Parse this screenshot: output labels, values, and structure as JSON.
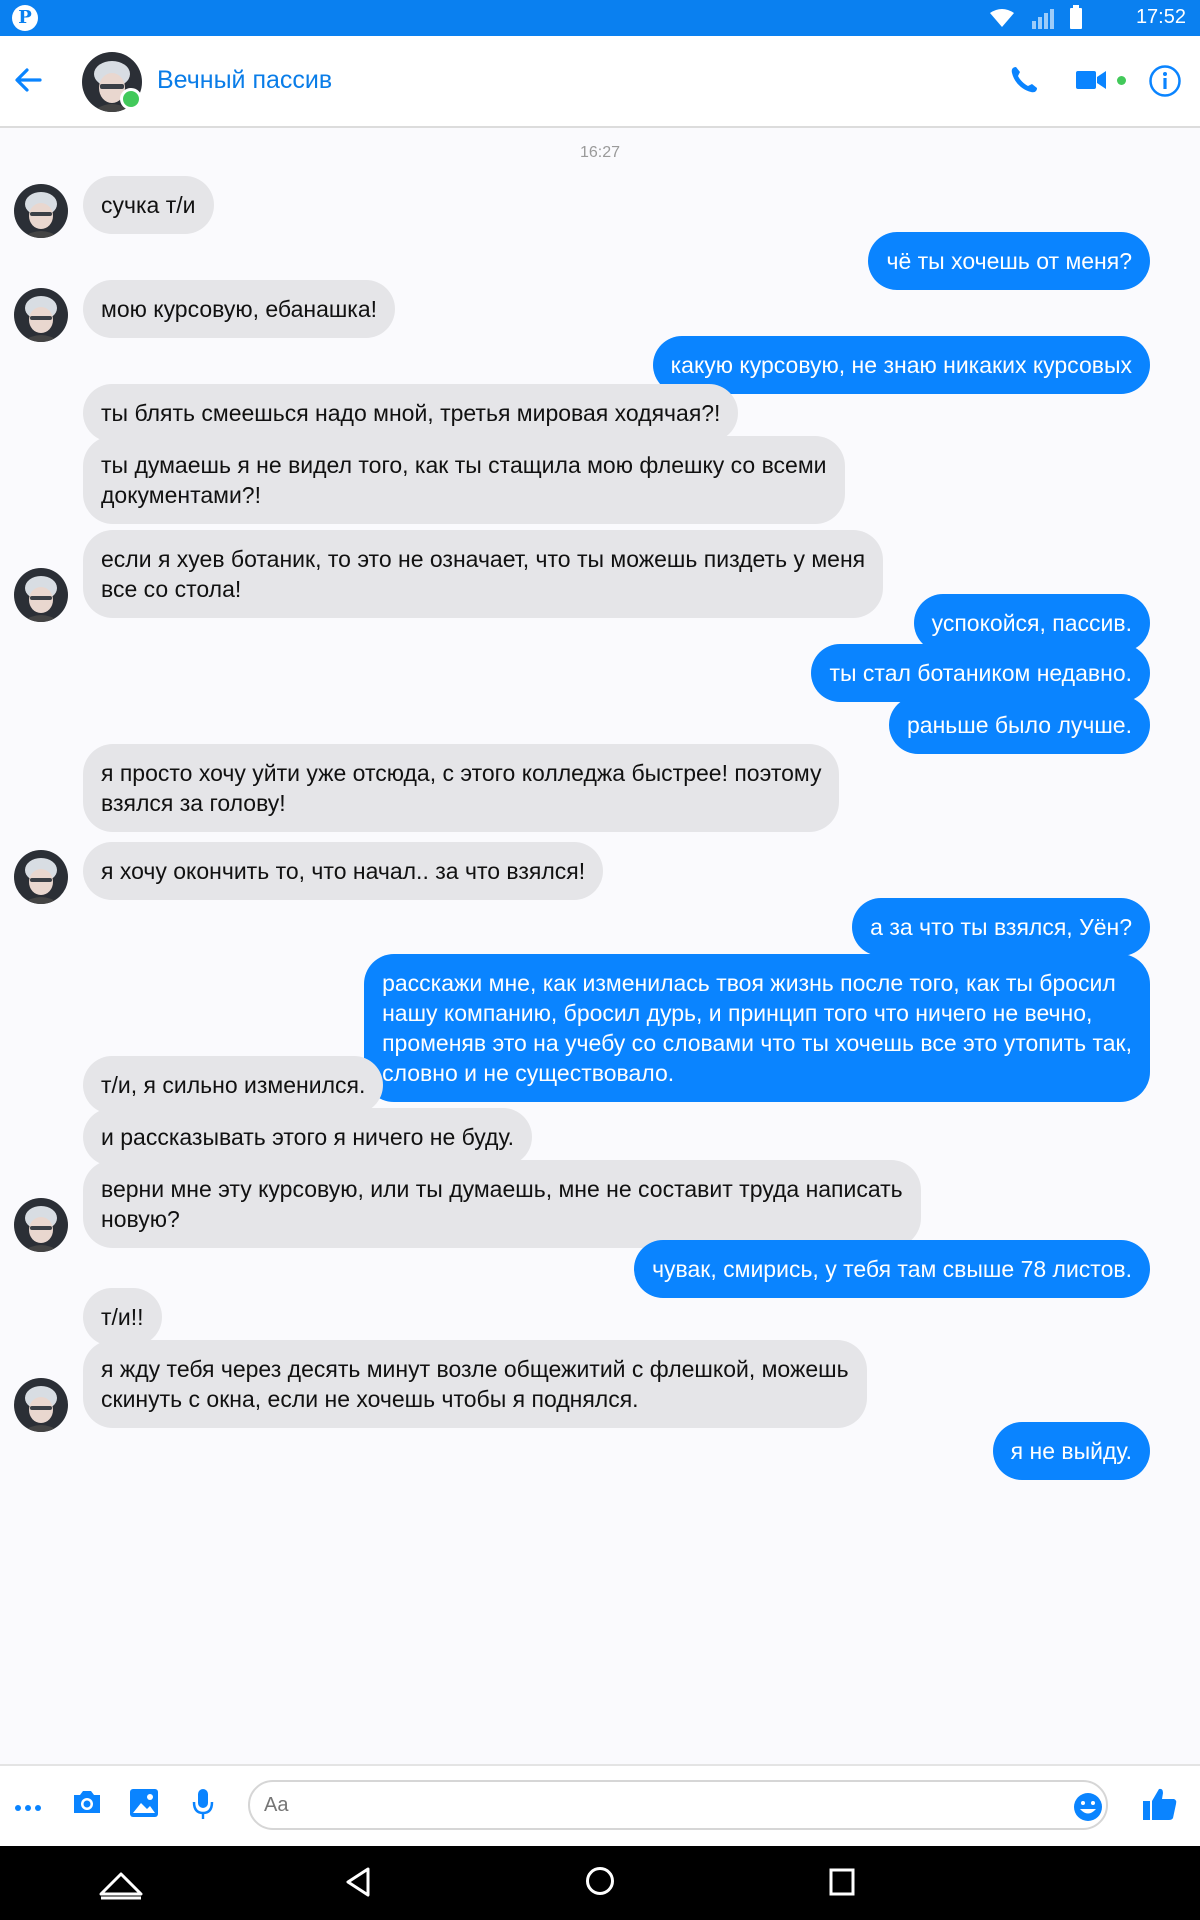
{
  "status_bar": {
    "time": "17:52"
  },
  "header": {
    "contact_name": "Вечный пассив",
    "online": true
  },
  "chat": {
    "timestamp": "16:27",
    "messages": [
      {
        "dir": "in",
        "text": "сучка т/и",
        "avatar": true
      },
      {
        "dir": "out",
        "text": "чё ты хочешь от меня?"
      },
      {
        "dir": "in",
        "text": "мою курсовую, ебанашка!",
        "avatar": true
      },
      {
        "dir": "out",
        "text": "какую курсовую, не знаю никаких курсовых"
      },
      {
        "dir": "in",
        "text": "ты блять смеешься надо мной, третья мировая ходячая?!"
      },
      {
        "dir": "in",
        "text": "ты думаешь я не видел того, как ты стащила мою флешку со всеми\nдокументами?!"
      },
      {
        "dir": "in",
        "text": "если я хуев ботаник, то это не означает, что ты можешь пиздеть у меня\nвсе со стола!",
        "avatar": true
      },
      {
        "dir": "out",
        "text": "успокойся, пассив."
      },
      {
        "dir": "out",
        "text": "ты стал ботаником недавно."
      },
      {
        "dir": "out",
        "text": "раньше было лучше."
      },
      {
        "dir": "in",
        "text": "я просто хочу уйти уже отсюда, с этого колледжа быстрее! поэтому\nвзялся за голову!"
      },
      {
        "dir": "in",
        "text": "я хочу окончить то, что начал.. за что взялся!",
        "avatar": true
      },
      {
        "dir": "out",
        "text": "а за что ты взялся, Уён?"
      },
      {
        "dir": "out",
        "text": "расскажи мне, как изменилась твоя жизнь после того, как ты бросил\nнашу компанию, бросил дурь, и принцип того что ничего не вечно,\nпроменяв это на учебу со словами что ты хочешь все это утопить так,\nсловно и не существовало."
      },
      {
        "dir": "in",
        "text": "т/и, я сильно изменился."
      },
      {
        "dir": "in",
        "text": "и рассказывать этого я ничего не буду."
      },
      {
        "dir": "in",
        "text": "верни мне эту курсовую, или ты думаешь, мне не составит труда написать\nновую?",
        "avatar": true
      },
      {
        "dir": "out",
        "text": "чувак, смирись, у тебя там свыше 78 листов."
      },
      {
        "dir": "in",
        "text": "т/и!!"
      },
      {
        "dir": "in",
        "text": "я жду тебя через десять минут возле общежитий с флешкой, можешь\nскинуть с окна, если не хочешь чтобы я поднялся.",
        "avatar": true
      },
      {
        "dir": "out",
        "text": "я не выйду."
      }
    ]
  },
  "composer": {
    "placeholder": "Aa"
  },
  "colors": {
    "brand": "#0a84ff",
    "incoming": "#e5e5e8",
    "online": "#42c95a"
  },
  "icons": [
    "back-arrow-icon",
    "phone-icon",
    "video-icon",
    "info-icon",
    "more-icon",
    "camera-icon",
    "gallery-icon",
    "microphone-icon",
    "emoji-icon",
    "like-icon",
    "nav-home-icon",
    "nav-back-icon",
    "nav-circle-icon",
    "nav-recents-icon"
  ]
}
